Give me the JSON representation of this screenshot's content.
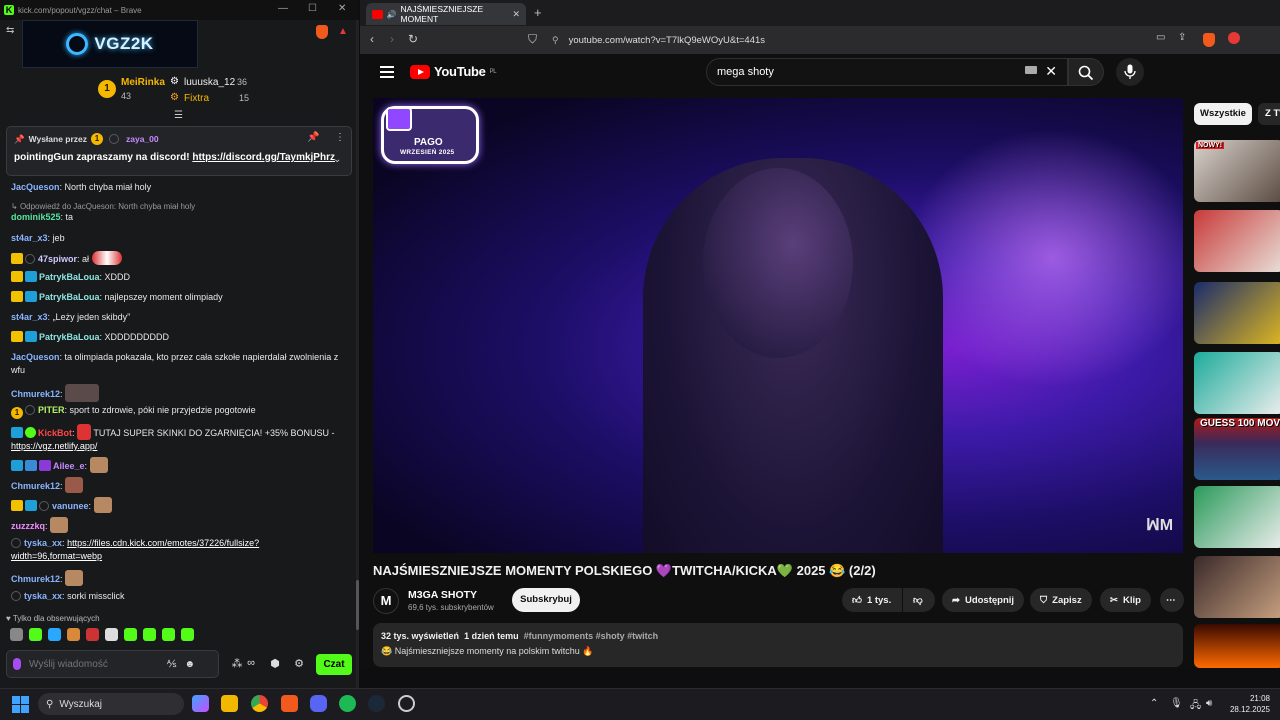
{
  "chat_window": {
    "title": "kick.com/popout/vgzz/chat – Brave",
    "logo_text": "VGZ2K",
    "leaderboard": [
      {
        "rank": "1",
        "name": "MeiRinka",
        "count": "43"
      },
      {
        "rank": "",
        "name": "luuuska_12",
        "count": "36"
      },
      {
        "rank": "",
        "name": "Fixtra",
        "count": "15"
      }
    ],
    "pinned": {
      "sent_by_label": "Wysłane przez",
      "sent_by_user": "zaya_00",
      "text": "pointingGun zapraszamy na discord!",
      "link": "https://discord.gg/TaymkjPhrz"
    },
    "messages": [
      {
        "user": "JacQueson",
        "color": "#8ab4ff",
        "text": "North chyba miał holy"
      },
      {
        "reply": "Odpowiedź do JacQueson: North chyba miał holy"
      },
      {
        "user": "dominik525",
        "color": "#56e39f",
        "text": "ta"
      },
      {
        "user": "st4ar_x3",
        "color": "#8ab4ff",
        "text": "jeb"
      },
      {
        "user": "47spiwor",
        "color": "#d0c8ff",
        "text": "ał"
      },
      {
        "user": "PatrykBaLoua",
        "color": "#8ee3e0",
        "text": "XDDD"
      },
      {
        "user": "PatrykBaLoua",
        "color": "#8ee3e0",
        "text": "najlepszey moment olimpiady"
      },
      {
        "user": "st4ar_x3",
        "color": "#8ab4ff",
        "text": "„Leży jeden skibdy”"
      },
      {
        "user": "PatrykBaLoua",
        "color": "#8ee3e0",
        "text": "XDDDDDDDDD"
      },
      {
        "user": "JacQueson",
        "color": "#8ab4ff",
        "text": "ta olimpiada pokazała, kto przez cała szkołe napierdalał zwolnienia z wfu"
      },
      {
        "user": "Chmurek12",
        "color": "#8ab4ff",
        "text": ""
      },
      {
        "user": "PITER",
        "color": "#b6f26a",
        "text": "sport to zdrowie, póki nie przyjedzie pogotowie"
      },
      {
        "user": "KickBot",
        "color": "#ff4747",
        "text": "TUTAJ SUPER SKINKI DO ZGARNIĘCIA! +35% BONUSU -",
        "link": "https://vgz.netlify.app/"
      },
      {
        "user": "Ailee_e",
        "color": "#c58bff",
        "text": ""
      },
      {
        "user": "Chmurek12",
        "color": "#8ab4ff",
        "text": ""
      },
      {
        "user": "vanunee",
        "color": "#8ab4ff",
        "text": ""
      },
      {
        "user": "zuzzzkq",
        "color": "#f08bff",
        "text": ""
      },
      {
        "user": "tyska_xx",
        "color": "#8ab4ff",
        "link": "https://files.cdn.kick.com/emotes/37226/fullsize?width=96,format=webp",
        "link_line1": "https://files.cdn.kick.com/emotes/37226/fullsize?",
        "link_line2": "width=96,format=webp"
      },
      {
        "user": "Chmurek12",
        "color": "#8ab4ff",
        "text": ""
      },
      {
        "user": "tyska_xx",
        "color": "#8ab4ff",
        "text": "sorki missclick"
      }
    ],
    "followers_only": "Tylko dla obserwujących",
    "input_placeholder": "Wyślij wiadomość",
    "send_label": "Czat"
  },
  "browser": {
    "tab_title": "NAJŚMIESZNIEJSZE MOMENT",
    "url": "youtube.com/watch?v=T7lkQ9eWOyU&t=441s"
  },
  "youtube": {
    "logo": "YouTube",
    "region": "PL",
    "search_query": "mega shoty",
    "video_badge_line1": "PAGO",
    "video_badge_line2": "WRZESIEŃ 2025",
    "title": "NAJŚMIESZNIEJSZE MOMENTY POLSKIEGO 💜TWITCHA/KICKA💚 2025 😂 (2/2)",
    "channel_name": "M3GA SHOTY",
    "channel_avatar": "M",
    "subscribers": "69,6 tys. subskrybentów",
    "subscribe_label": "Subskrybuj",
    "likes": "1 tys.",
    "share_label": "Udostępnij",
    "save_label": "Zapisz",
    "clip_label": "Klip",
    "views": "32 tys. wyświetleń",
    "age": "1 dzień temu",
    "hashtags": "#funnymoments #shoty #twitch",
    "description": "😂 Najśmieszniejsze momenty na polskim twitchu 🔥",
    "chips": [
      "Wszystkie",
      "Z TW"
    ],
    "thumbs": [
      "NOWY!",
      "",
      "",
      "",
      "GUESS 100 MOV",
      "",
      "",
      ""
    ]
  },
  "taskbar": {
    "search_placeholder": "Wyszukaj",
    "time": "21:08",
    "date": "28.12.2025"
  }
}
